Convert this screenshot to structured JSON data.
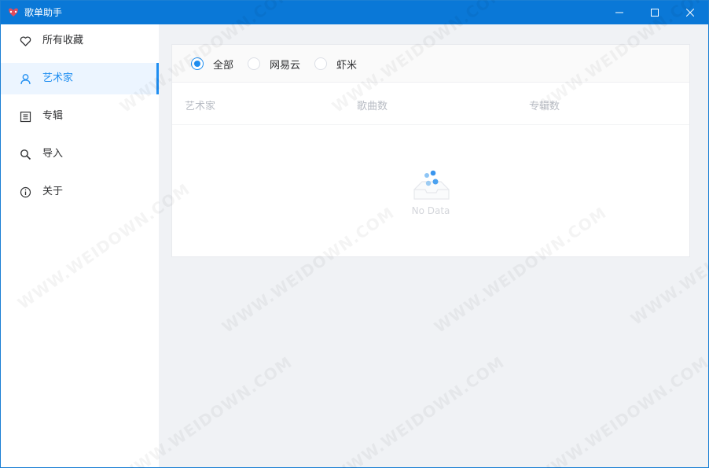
{
  "window": {
    "title": "歌单助手"
  },
  "sidebar": {
    "items": [
      {
        "label": "所有收藏",
        "icon": "heart-icon",
        "active": false
      },
      {
        "label": "艺术家",
        "icon": "user-icon",
        "active": true
      },
      {
        "label": "专辑",
        "icon": "album-icon",
        "active": false
      },
      {
        "label": "导入",
        "icon": "search-icon",
        "active": false
      },
      {
        "label": "关于",
        "icon": "info-icon",
        "active": false
      }
    ]
  },
  "filter": {
    "options": [
      {
        "label": "全部",
        "checked": true
      },
      {
        "label": "网易云",
        "checked": false
      },
      {
        "label": "虾米",
        "checked": false
      }
    ]
  },
  "table": {
    "columns": [
      "艺术家",
      "歌曲数",
      "专辑数"
    ],
    "rows": [],
    "empty_text": "No Data"
  },
  "watermark": {
    "text": "WWW.WEIDOWN.COM"
  },
  "colors": {
    "titlebar": "#0a78d7",
    "accent": "#1f8ef1",
    "active_bg": "#ecf5ff"
  }
}
